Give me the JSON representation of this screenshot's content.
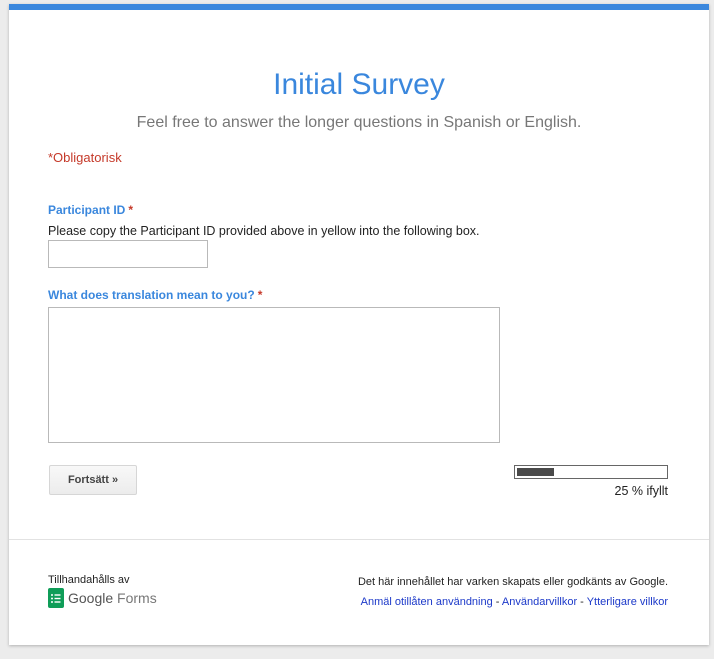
{
  "form": {
    "title": "Initial Survey",
    "description": "Feel free to answer the longer questions in Spanish or English.",
    "required_note": "*Obligatorisk"
  },
  "questions": [
    {
      "label": "Participant ID",
      "required_marker": "*",
      "help_text": "Please copy the Participant ID provided above in yellow into the following box.",
      "value": ""
    },
    {
      "label": "What does translation mean to you?",
      "required_marker": "*",
      "value": ""
    }
  ],
  "navigation": {
    "continue_label": "Fortsätt »"
  },
  "progress": {
    "fraction": 0.25,
    "label": "25 % ifyllt"
  },
  "footer": {
    "provided_by": "Tillhandahålls av",
    "brand_google": "Google",
    "brand_forms": "Forms",
    "disclaimer": "Det här innehållet har varken skapats eller godkänts av Google.",
    "links": [
      "Anmäl otillåten användning",
      "Användarvillkor",
      "Ytterligare villkor"
    ],
    "separator": " - "
  },
  "colors": {
    "accent": "#3a87dd",
    "required": "#c53929",
    "link": "#1c39c9",
    "forms_green": "#0f9d58"
  }
}
